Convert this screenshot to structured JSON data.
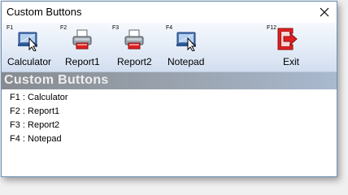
{
  "window": {
    "title": "Custom Buttons"
  },
  "toolbar": {
    "buttons": [
      {
        "fkey": "F1",
        "label": "Calculator",
        "icon": "calculator-icon"
      },
      {
        "fkey": "F2",
        "label": "Report1",
        "icon": "printer-icon"
      },
      {
        "fkey": "F3",
        "label": "Report2",
        "icon": "printer-icon"
      },
      {
        "fkey": "F4",
        "label": "Notepad",
        "icon": "notepad-icon"
      },
      {
        "fkey": "F12",
        "label": "Exit",
        "icon": "exit-icon"
      }
    ]
  },
  "banner": {
    "text": "Custom Buttons"
  },
  "content": {
    "lines": [
      "F1 : Calculator",
      "F2 : Report1",
      "F3 : Report2",
      "F4 : Notepad"
    ]
  },
  "colors": {
    "toolbar_top": "#f6f9fd",
    "toolbar_bottom": "#d2def0",
    "banner_dark": "#878b91",
    "banner_light": "#a9b9cf",
    "exit_red": "#e02020"
  }
}
